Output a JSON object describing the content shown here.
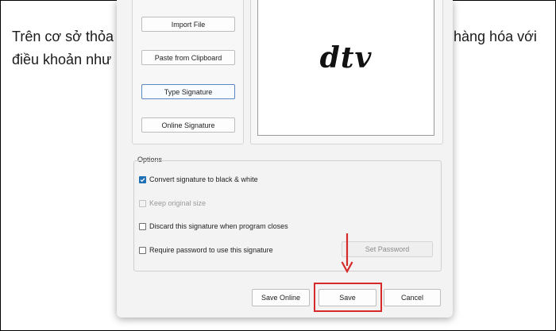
{
  "document": {
    "line1_left": "Trên cơ sở thỏa",
    "line1_right": "n hàng hóa với",
    "line2_left": "điều khoản như"
  },
  "signature_sources": {
    "import_file": "Import File",
    "paste_clipboard": "Paste from Clipboard",
    "type_signature": "Type Signature",
    "online_signature": "Online Signature"
  },
  "preview": {
    "signature_text": "dtv"
  },
  "options": {
    "title": "Options",
    "convert_bw": {
      "label": "Convert signature to black & white",
      "checked": true
    },
    "keep_size": {
      "label": "Keep original size",
      "checked": false,
      "enabled": false
    },
    "discard_on_close": {
      "label": "Discard this signature when program closes",
      "checked": false
    },
    "require_password": {
      "label": "Require password to use this signature",
      "checked": false
    },
    "set_password_label": "Set Password"
  },
  "footer": {
    "save_online": "Save Online",
    "save": "Save",
    "cancel": "Cancel"
  },
  "colors": {
    "accent": "#1f6fb5",
    "highlight": "#d62a2a"
  }
}
